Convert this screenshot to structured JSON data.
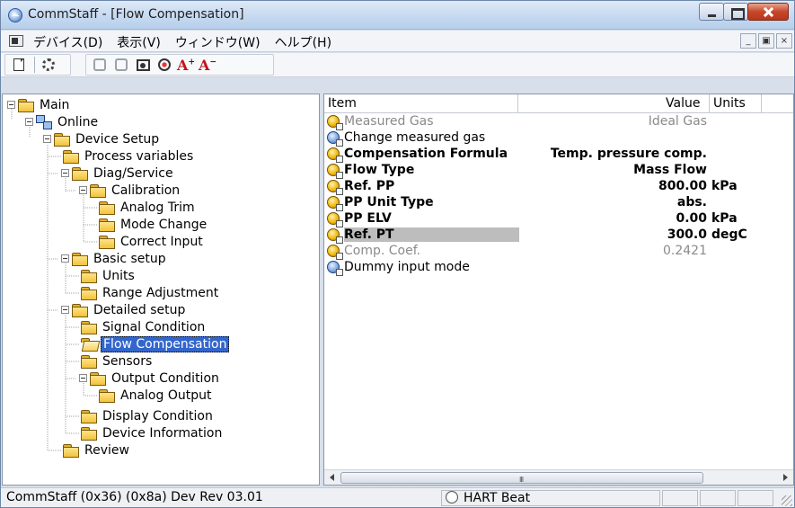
{
  "window": {
    "title": "CommStaff - [Flow Compensation]"
  },
  "menu": {
    "items": [
      "デバイス(D)",
      "表示(V)",
      "ウィンドウ(W)",
      "ヘルプ(H)"
    ]
  },
  "tree": {
    "nodes": [
      {
        "label": "Main"
      },
      {
        "label": "Online"
      },
      {
        "label": "Device Setup"
      },
      {
        "label": "Process variables"
      },
      {
        "label": "Diag/Service"
      },
      {
        "label": "Calibration"
      },
      {
        "label": "Analog Trim"
      },
      {
        "label": "Mode Change"
      },
      {
        "label": "Correct Input"
      },
      {
        "label": "Basic setup"
      },
      {
        "label": "Units"
      },
      {
        "label": "Range Adjustment"
      },
      {
        "label": "Detailed setup"
      },
      {
        "label": "Signal Condition"
      },
      {
        "label": "Flow Compensation"
      },
      {
        "label": "Sensors"
      },
      {
        "label": "Output Condition"
      },
      {
        "label": "Analog Output"
      },
      {
        "label": "Display Condition"
      },
      {
        "label": "Device Information"
      },
      {
        "label": "Review"
      }
    ]
  },
  "list": {
    "columns": {
      "item": "Item",
      "value": "Value",
      "units": "Units"
    },
    "rows": [
      {
        "item": "Measured Gas",
        "value": "Ideal Gas",
        "units": "",
        "icon": "yellow-param-icon"
      },
      {
        "item": "Change measured gas",
        "value": "",
        "units": "",
        "icon": "blue-method-icon"
      },
      {
        "item": "Compensation Formula",
        "value": "Temp. pressure comp.",
        "units": "",
        "icon": "yellow-param-icon"
      },
      {
        "item": "Flow Type",
        "value": "Mass Flow",
        "units": "",
        "icon": "yellow-param-icon"
      },
      {
        "item": "Ref. PP",
        "value": "800.00",
        "units": "kPa",
        "icon": "yellow-param-icon"
      },
      {
        "item": "PP Unit Type",
        "value": "abs.",
        "units": "",
        "icon": "yellow-param-icon"
      },
      {
        "item": "PP ELV",
        "value": "0.00",
        "units": "kPa",
        "icon": "yellow-param-icon"
      },
      {
        "item": "Ref. PT",
        "value": "300.0",
        "units": "degC",
        "icon": "yellow-param-icon"
      },
      {
        "item": "Comp. Coef.",
        "value": "0.2421",
        "units": "",
        "icon": "yellow-param-icon"
      },
      {
        "item": "Dummy input mode",
        "value": "",
        "units": "",
        "icon": "blue-method-icon"
      }
    ]
  },
  "scrollbar": {
    "grip": "III"
  },
  "status": {
    "info": "CommStaff  (0x36)  (0x8a) Dev Rev 03.01",
    "beat": "HART Beat"
  },
  "mdi_buttons": [
    "_",
    "ₐ",
    "×"
  ]
}
